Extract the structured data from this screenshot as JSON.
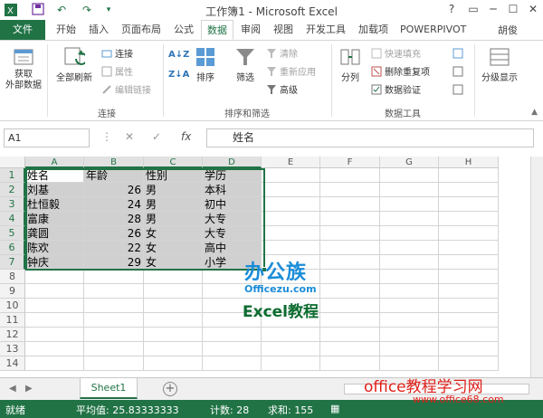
{
  "window": {
    "title": "工作簿1 - Microsoft Excel",
    "controls": [
      "?",
      "▭",
      "─",
      "☐",
      "✕"
    ]
  },
  "quick_access": [
    "save-icon",
    "undo-icon",
    "redo-icon",
    "customize-icon"
  ],
  "ribbon_tabs": [
    "文件",
    "开始",
    "插入",
    "页面布局",
    "公式",
    "数据",
    "审阅",
    "视图",
    "开发工具",
    "加载项",
    "POWERPIVOT"
  ],
  "active_tab": "数据",
  "user": "胡俊",
  "ribbon": {
    "get_external_data": "获取\n外部数据",
    "refresh_all": "全部刷新",
    "connections": "连接",
    "properties": "属性",
    "edit_links": "编辑链接",
    "group_connections": "连接",
    "sort": "排序",
    "filter": "筛选",
    "clear": "清除",
    "reapply": "重新应用",
    "advanced": "高级",
    "group_sort_filter": "排序和筛选",
    "text_to_columns": "分列",
    "flash_fill": "快速填充",
    "remove_duplicates": "删除重复项",
    "data_validation": "数据验证",
    "group_data_tools": "数据工具",
    "outline": "分级显示"
  },
  "formula_bar": {
    "name_box": "A1",
    "formula": "姓名",
    "fx": "fx"
  },
  "grid": {
    "columns": [
      "A",
      "B",
      "C",
      "D",
      "E",
      "F",
      "G",
      "H"
    ],
    "rows": [
      "1",
      "2",
      "3",
      "4",
      "5",
      "6",
      "7",
      "8",
      "9",
      "10",
      "11",
      "12",
      "13",
      "14"
    ],
    "cells": [
      [
        "姓名",
        "年龄",
        "性别",
        "学历"
      ],
      [
        "刘基",
        "26",
        "男",
        "本科"
      ],
      [
        "杜恒毅",
        "24",
        "男",
        "初中"
      ],
      [
        "富康",
        "28",
        "男",
        "大专"
      ],
      [
        "龚圆",
        "26",
        "女",
        "大专"
      ],
      [
        "陈欢",
        "22",
        "女",
        "高中"
      ],
      [
        "钟庆",
        "29",
        "女",
        "小学"
      ]
    ]
  },
  "sheet_tabs": [
    "Sheet1"
  ],
  "status": {
    "ready": "就绪",
    "average": "平均值: 25.83333333",
    "count": "计数: 28",
    "sum": "求和: 155"
  },
  "watermark": {
    "logo": "办公族",
    "logo_sub": "Officezu.com",
    "excel": "Excel教程",
    "site": "office教程学习网",
    "url": "www.office68.com"
  },
  "colors": {
    "accent": "#217346",
    "selection": "#d0d0d0",
    "watermark_blue": "#1a8cd8",
    "watermark_red": "#e0201a"
  }
}
